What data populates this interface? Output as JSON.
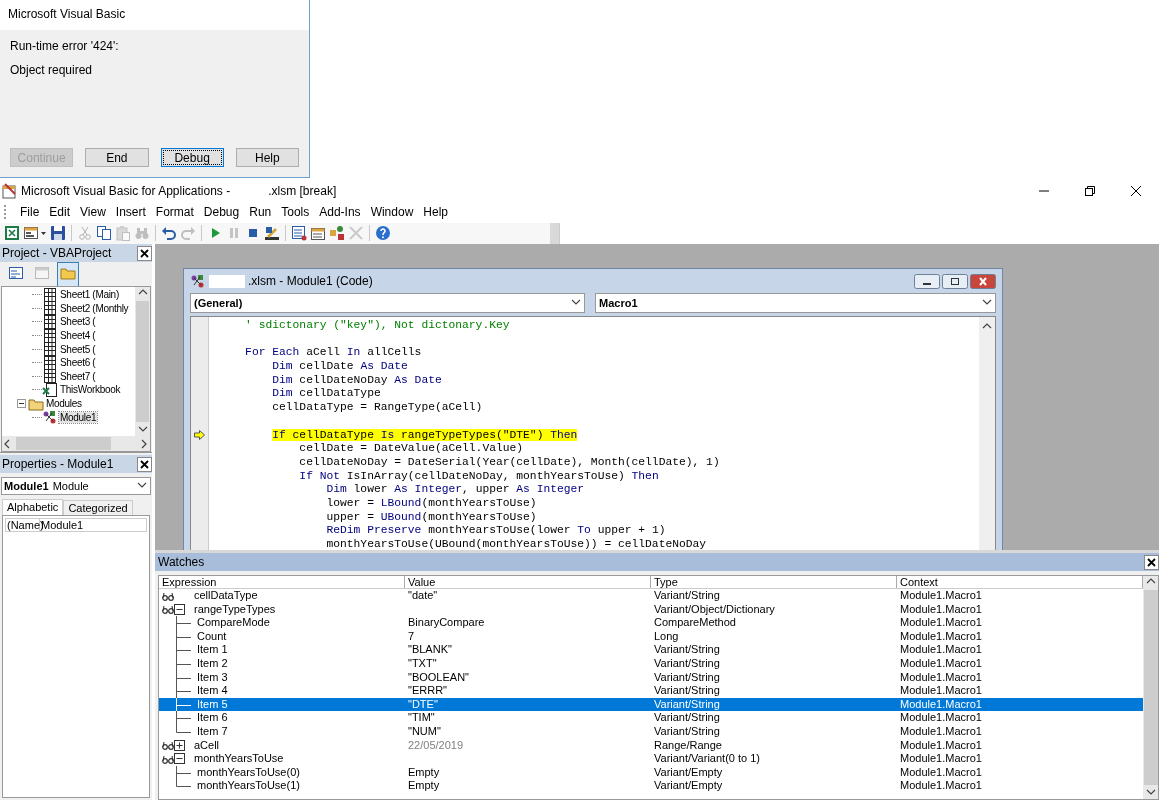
{
  "error_dialog": {
    "title": "Microsoft Visual Basic",
    "message": "Run-time error '424':",
    "detail": "Object required",
    "buttons": [
      {
        "label": "Continue",
        "disabled": true,
        "focused": false
      },
      {
        "label": "End",
        "disabled": false,
        "focused": false
      },
      {
        "label": "Debug",
        "disabled": false,
        "focused": true
      },
      {
        "label": "Help",
        "disabled": false,
        "focused": false
      }
    ]
  },
  "window": {
    "title": "Microsoft Visual Basic for Applications -",
    "title_suffix": ".xlsm [break]"
  },
  "menu": [
    "File",
    "Edit",
    "View",
    "Insert",
    "Format",
    "Debug",
    "Run",
    "Tools",
    "Add-Ins",
    "Window",
    "Help"
  ],
  "toolbar": [
    {
      "kind": "excel",
      "disabled": false
    },
    {
      "kind": "form",
      "disabled": false
    },
    {
      "kind": "save",
      "disabled": false
    },
    {
      "kind": "separator"
    },
    {
      "kind": "cut",
      "disabled": true
    },
    {
      "kind": "copy",
      "disabled": false
    },
    {
      "kind": "paste",
      "disabled": true
    },
    {
      "kind": "find",
      "disabled": true
    },
    {
      "kind": "separator"
    },
    {
      "kind": "undo",
      "disabled": false
    },
    {
      "kind": "redo",
      "disabled": true
    },
    {
      "kind": "separator"
    },
    {
      "kind": "run",
      "disabled": false
    },
    {
      "kind": "pause",
      "disabled": true
    },
    {
      "kind": "stop",
      "disabled": false
    },
    {
      "kind": "design",
      "disabled": false
    },
    {
      "kind": "separator"
    },
    {
      "kind": "project",
      "disabled": false
    },
    {
      "kind": "properties",
      "disabled": false
    },
    {
      "kind": "object_browser",
      "disabled": false
    },
    {
      "kind": "toolbox",
      "disabled": true
    },
    {
      "kind": "separator"
    },
    {
      "kind": "help",
      "disabled": false
    }
  ],
  "project_pane": {
    "title": "Project - VBAProject",
    "toolbar": [
      {
        "kind": "code",
        "disabled": false,
        "pressed": false
      },
      {
        "kind": "object",
        "disabled": true,
        "pressed": false
      },
      {
        "kind": "folders",
        "disabled": false,
        "pressed": true
      }
    ],
    "tree": [
      {
        "children": [
          {
            "label": "Sheet1 (Main)",
            "kind": "sheet",
            "selected": false
          },
          {
            "label": "Sheet2 (Monthly",
            "kind": "sheet",
            "selected": false
          },
          {
            "label": "Sheet3 (",
            "kind": "sheet",
            "selected": false
          },
          {
            "label": "Sheet4 (",
            "kind": "sheet",
            "selected": false
          },
          {
            "label": "Sheet5 (",
            "kind": "sheet",
            "selected": false
          },
          {
            "label": "Sheet6 (",
            "kind": "sheet",
            "selected": false
          },
          {
            "label": "Sheet7 (",
            "kind": "sheet",
            "selected": false
          },
          {
            "label": "ThisWorkbook",
            "kind": "workbook",
            "selected": false
          }
        ]
      },
      {
        "label": "Modules",
        "kind": "folder",
        "selected": false,
        "expanded": true,
        "children": [
          {
            "label": "Module1",
            "kind": "module",
            "selected": true
          }
        ]
      }
    ]
  },
  "properties_pane": {
    "title": "Properties - Module1",
    "object_name": "Module1",
    "object_type": "Module",
    "tabs": [
      {
        "label": "Alphabetic",
        "selected": true
      },
      {
        "label": "Categorized",
        "selected": false
      }
    ],
    "rows": [
      {
        "name": "(Name)",
        "value": "Module1"
      }
    ]
  },
  "code_window": {
    "title": ".xlsm - Module1 (Code)",
    "object_dropdown": "(General)",
    "procedure_dropdown": "Macro1",
    "lines": [
      {
        "current": false,
        "segments": [
          {
            "kind": "comment",
            "text": "    ' sdictonary (\"key\"), Not dictonary.Key"
          }
        ]
      },
      {
        "current": false
      },
      {
        "current": false,
        "segments": [
          {
            "kind": "keyword",
            "text": "    For Each"
          },
          {
            "kind": "plain",
            "text": " aCell "
          },
          {
            "kind": "keyword",
            "text": "In"
          },
          {
            "kind": "plain",
            "text": " allCells"
          }
        ]
      },
      {
        "current": false,
        "segments": [
          {
            "kind": "keyword",
            "text": "        Dim"
          },
          {
            "kind": "plain",
            "text": " cellDate "
          },
          {
            "kind": "keyword",
            "text": "As Date"
          }
        ]
      },
      {
        "current": false,
        "segments": [
          {
            "kind": "keyword",
            "text": "        Dim"
          },
          {
            "kind": "plain",
            "text": " cellDateNoDay "
          },
          {
            "kind": "keyword",
            "text": "As Date"
          }
        ]
      },
      {
        "current": false,
        "segments": [
          {
            "kind": "keyword",
            "text": "        Dim"
          },
          {
            "kind": "plain",
            "text": " cellDataType"
          }
        ]
      },
      {
        "current": false,
        "segments": [
          {
            "kind": "plain",
            "text": "        cellDataType = RangeType(aCell)"
          }
        ]
      },
      {
        "current": false
      },
      {
        "current": true,
        "segments": [
          {
            "kind": "keyword",
            "text": "        If"
          },
          {
            "kind": "plain",
            "text": " cellDataType "
          },
          {
            "kind": "keyword",
            "text": "Is"
          },
          {
            "kind": "plain",
            "text": " rangeTypeTypes(\"DTE\") "
          },
          {
            "kind": "keyword",
            "text": "Then"
          }
        ]
      },
      {
        "current": false,
        "segments": [
          {
            "kind": "plain",
            "text": "            cellDate = DateValue(aCell.Value)"
          }
        ]
      },
      {
        "current": false,
        "segments": [
          {
            "kind": "plain",
            "text": "            cellDateNoDay = DateSerial(Year(cellDate), Month(cellDate), 1)"
          }
        ]
      },
      {
        "current": false,
        "segments": [
          {
            "kind": "keyword",
            "text": "            If Not"
          },
          {
            "kind": "plain",
            "text": " IsInArray(cellDateNoDay, monthYearsToUse) "
          },
          {
            "kind": "keyword",
            "text": "Then"
          }
        ]
      },
      {
        "current": false,
        "segments": [
          {
            "kind": "keyword",
            "text": "                Dim"
          },
          {
            "kind": "plain",
            "text": " lower "
          },
          {
            "kind": "keyword",
            "text": "As Integer"
          },
          {
            "kind": "plain",
            "text": ", upper "
          },
          {
            "kind": "keyword",
            "text": "As Integer"
          }
        ]
      },
      {
        "current": false,
        "segments": [
          {
            "kind": "plain",
            "text": "                lower = "
          },
          {
            "kind": "keyword",
            "text": "LBound"
          },
          {
            "kind": "plain",
            "text": "(monthYearsToUse)"
          }
        ]
      },
      {
        "current": false,
        "segments": [
          {
            "kind": "plain",
            "text": "                upper = "
          },
          {
            "kind": "keyword",
            "text": "UBound"
          },
          {
            "kind": "plain",
            "text": "(monthYearsToUse)"
          }
        ]
      },
      {
        "current": false,
        "segments": [
          {
            "kind": "keyword",
            "text": "                ReDim Preserve"
          },
          {
            "kind": "plain",
            "text": " monthYearsToUse(lower "
          },
          {
            "kind": "keyword",
            "text": "To"
          },
          {
            "kind": "plain",
            "text": " upper + 1)"
          }
        ]
      },
      {
        "current": false,
        "segments": [
          {
            "kind": "plain",
            "text": "                monthYearsToUse(UBound(monthYearsToUse)) = cellDateNoDay"
          }
        ]
      }
    ]
  },
  "watches": {
    "title": "Watches",
    "columns": [
      "Expression",
      "Value",
      "Type",
      "Context"
    ],
    "rows": [
      {
        "expression": "cellDataType",
        "value": "\"date\"",
        "type": "Variant/String",
        "context": "Module1.Macro1",
        "selected": false,
        "dimmed": false
      },
      {
        "expression": "rangeTypeTypes",
        "type": "Variant/Object/Dictionary",
        "context": "Module1.Macro1",
        "selected": false,
        "dimmed": false,
        "expanded": true,
        "children": [
          {
            "expression": "CompareMode",
            "value": "BinaryCompare",
            "type": "CompareMethod",
            "context": "Module1.Macro1",
            "selected": false
          },
          {
            "expression": "Count",
            "value": "7",
            "type": "Long",
            "context": "Module1.Macro1",
            "selected": false
          },
          {
            "expression": "Item 1",
            "value": "\"BLANK\"",
            "type": "Variant/String",
            "context": "Module1.Macro1",
            "selected": false
          },
          {
            "expression": "Item 2",
            "value": "\"TXT\"",
            "type": "Variant/String",
            "context": "Module1.Macro1",
            "selected": false
          },
          {
            "expression": "Item 3",
            "value": "\"BOOLEAN\"",
            "type": "Variant/String",
            "context": "Module1.Macro1",
            "selected": false
          },
          {
            "expression": "Item 4",
            "value": "\"ERRR\"",
            "type": "Variant/String",
            "context": "Module1.Macro1",
            "selected": false
          },
          {
            "expression": "Item 5",
            "value": "\"DTE\"",
            "type": "Variant/String",
            "context": "Module1.Macro1",
            "selected": true
          },
          {
            "expression": "Item 6",
            "value": "\"TIM\"",
            "type": "Variant/String",
            "context": "Module1.Macro1",
            "selected": false
          },
          {
            "expression": "Item 7",
            "value": "\"NUM\"",
            "type": "Variant/String",
            "context": "Module1.Macro1",
            "selected": false
          }
        ]
      },
      {
        "expression": "aCell",
        "value": "22/05/2019",
        "type": "Range/Range",
        "context": "Module1.Macro1",
        "selected": false,
        "dimmed": true,
        "expanded": false
      },
      {
        "expression": "monthYearsToUse",
        "type": "Variant/Variant(0 to 1)",
        "context": "Module1.Macro1",
        "selected": false,
        "dimmed": false,
        "expanded": true,
        "children": [
          {
            "expression": "monthYearsToUse(0)",
            "value": "Empty",
            "type": "Variant/Empty",
            "context": "Module1.Macro1",
            "selected": false
          },
          {
            "expression": "monthYearsToUse(1)",
            "value": "Empty",
            "type": "Variant/Empty",
            "context": "Module1.Macro1",
            "selected": false
          }
        ]
      }
    ]
  }
}
